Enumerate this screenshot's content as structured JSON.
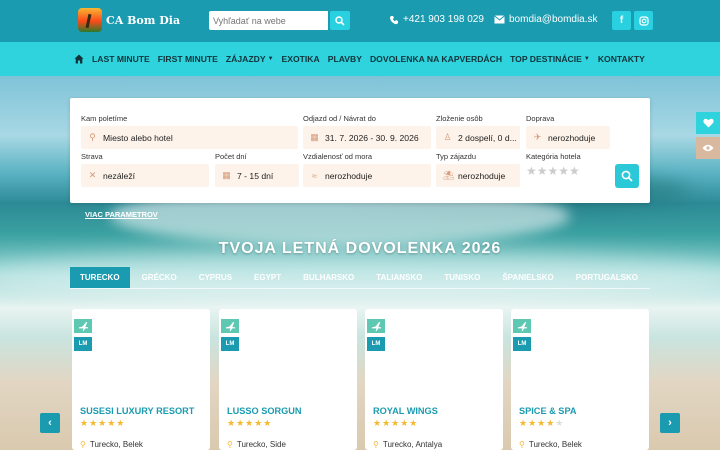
{
  "brand": {
    "name": "CA Bom Dia"
  },
  "search": {
    "placeholder": "Vyhľadať na webe"
  },
  "contacts": {
    "phone": "+421 903 198 029",
    "email": "bomdia@bomdia.sk"
  },
  "social": [
    "facebook-icon",
    "instagram-icon"
  ],
  "nav": {
    "items": [
      {
        "label": "LAST MINUTE",
        "dropdown": false
      },
      {
        "label": "FIRST MINUTE",
        "dropdown": false
      },
      {
        "label": "ZÁJAZDY",
        "dropdown": true
      },
      {
        "label": "EXOTIKA",
        "dropdown": false
      },
      {
        "label": "PLAVBY",
        "dropdown": false
      },
      {
        "label": "DOVOLENKA NA KAPVERDÁCH",
        "dropdown": false
      },
      {
        "label": "TOP DESTINÁCIE",
        "dropdown": true
      },
      {
        "label": "KONTAKTY",
        "dropdown": false
      }
    ]
  },
  "searchPanel": {
    "destination": {
      "label": "Kam poletíme",
      "placeholder": "Miesto alebo hotel"
    },
    "dates": {
      "label": "Odjazd od / Návrat do",
      "value": "31. 7. 2026 - 30. 9. 2026"
    },
    "people": {
      "label": "Zloženie osôb",
      "value": "2 dospelí, 0 d..."
    },
    "transport": {
      "label": "Doprava",
      "value": "nerozhoduje"
    },
    "board": {
      "label": "Strava",
      "value": "nezáleží"
    },
    "nights": {
      "label": "Počet dní",
      "value": "7 - 15 dní"
    },
    "distance": {
      "label": "Vzdialenosť od mora",
      "value": "nerozhoduje"
    },
    "tripType": {
      "label": "Typ zájazdu",
      "value": "nerozhoduje"
    },
    "category": {
      "label": "Kategória hotela",
      "stars": 5
    }
  },
  "moreParams": "VIAC PARAMETROV",
  "headline": "TVOJA LETNÁ DOVOLENKA 2026",
  "tabs": [
    {
      "label": "TURECKO",
      "active": true
    },
    {
      "label": "GRÉCKO",
      "active": false
    },
    {
      "label": "CYPRUS",
      "active": false
    },
    {
      "label": "EGYPT",
      "active": false
    },
    {
      "label": "BULHARSKO",
      "active": false
    },
    {
      "label": "TALIANSKO",
      "active": false
    },
    {
      "label": "TUNISKO",
      "active": false
    },
    {
      "label": "ŠPANIELSKO",
      "active": false
    },
    {
      "label": "PORTUGALSKO",
      "active": false
    }
  ],
  "hotels": [
    {
      "name": "SUSESI LUXURY RESORT",
      "rating": 5,
      "location": "Turecko, Belek",
      "badge": "LM"
    },
    {
      "name": "LUSSO SORGUN",
      "rating": 5,
      "location": "Turecko, Side",
      "badge": "LM"
    },
    {
      "name": "ROYAL WINGS",
      "rating": 5,
      "location": "Turecko, Antalya",
      "badge": "LM"
    },
    {
      "name": "SPICE & SPA",
      "rating": 4.5,
      "location": "Turecko, Belek",
      "badge": "LM"
    }
  ],
  "colors": {
    "primary": "#1a9bb0",
    "accent": "#2ed3dd",
    "star": "#f5b82e",
    "fieldBg": "#fdf3ea"
  }
}
